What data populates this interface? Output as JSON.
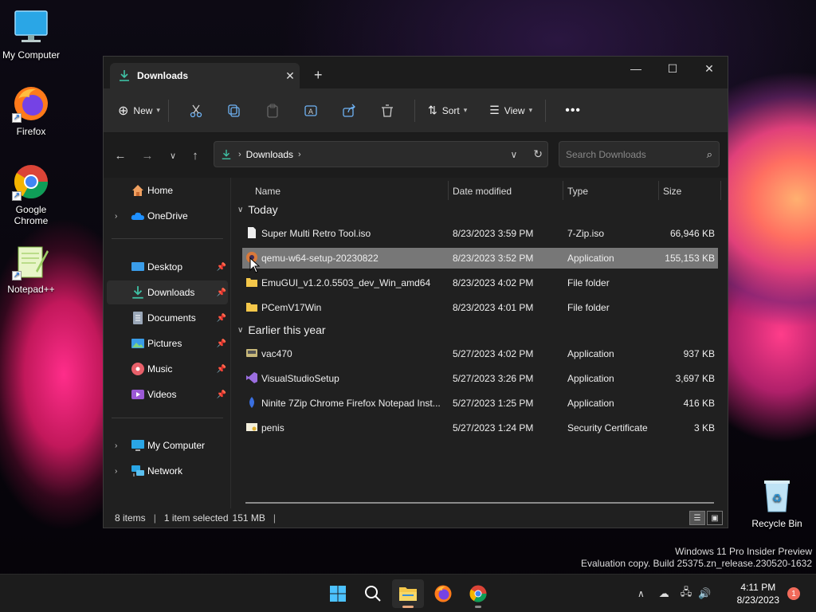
{
  "desktop": {
    "icons": [
      {
        "label": "My Computer"
      },
      {
        "label": "Firefox"
      },
      {
        "label": "Google Chrome"
      },
      {
        "label": "Notepad++"
      },
      {
        "label": "Recycle Bin"
      }
    ],
    "watermark": {
      "line1": "Windows 11 Pro Insider Preview",
      "line2": "Evaluation copy. Build 25375.zn_release.230520-1632"
    }
  },
  "window": {
    "tab": {
      "title": "Downloads"
    },
    "toolbar": {
      "new_label": "New",
      "sort_label": "Sort",
      "view_label": "View"
    },
    "address": {
      "location": "Downloads"
    },
    "search": {
      "placeholder": "Search Downloads"
    },
    "sidebar": {
      "items": [
        {
          "label": "Home"
        },
        {
          "label": "OneDrive"
        },
        {
          "label": "Desktop"
        },
        {
          "label": "Downloads"
        },
        {
          "label": "Documents"
        },
        {
          "label": "Pictures"
        },
        {
          "label": "Music"
        },
        {
          "label": "Videos"
        },
        {
          "label": "My Computer"
        },
        {
          "label": "Network"
        }
      ]
    },
    "columns": {
      "name": "Name",
      "date": "Date modified",
      "type": "Type",
      "size": "Size"
    },
    "groups": [
      {
        "title": "Today",
        "files": [
          {
            "name": "Super Multi Retro Tool.iso",
            "date": "8/23/2023 3:59 PM",
            "type": "7-Zip.iso",
            "size": "66,946 KB"
          },
          {
            "name": "qemu-w64-setup-20230822",
            "date": "8/23/2023 3:52 PM",
            "type": "Application",
            "size": "155,153 KB"
          },
          {
            "name": "EmuGUI_v1.2.0.5503_dev_Win_amd64",
            "date": "8/23/2023 4:02 PM",
            "type": "File folder",
            "size": ""
          },
          {
            "name": "PCemV17Win",
            "date": "8/23/2023 4:01 PM",
            "type": "File folder",
            "size": ""
          }
        ]
      },
      {
        "title": "Earlier this year",
        "files": [
          {
            "name": "vac470",
            "date": "5/27/2023 4:02 PM",
            "type": "Application",
            "size": "937 KB"
          },
          {
            "name": "VisualStudioSetup",
            "date": "5/27/2023 3:26 PM",
            "type": "Application",
            "size": "3,697 KB"
          },
          {
            "name": "Ninite 7Zip Chrome Firefox Notepad Inst...",
            "date": "5/27/2023 1:25 PM",
            "type": "Application",
            "size": "416 KB"
          },
          {
            "name": "penis",
            "date": "5/27/2023 1:24 PM",
            "type": "Security Certificate",
            "size": "3 KB"
          }
        ]
      }
    ],
    "status": {
      "items": "8 items",
      "selection": "1 item selected",
      "size": "151 MB"
    }
  },
  "taskbar": {
    "time": "4:11 PM",
    "date": "8/23/2023",
    "notifications": "1"
  },
  "colors": {
    "accent_download": "#3fc1a5",
    "selection": "#777777",
    "folder": "#f4c74a"
  }
}
